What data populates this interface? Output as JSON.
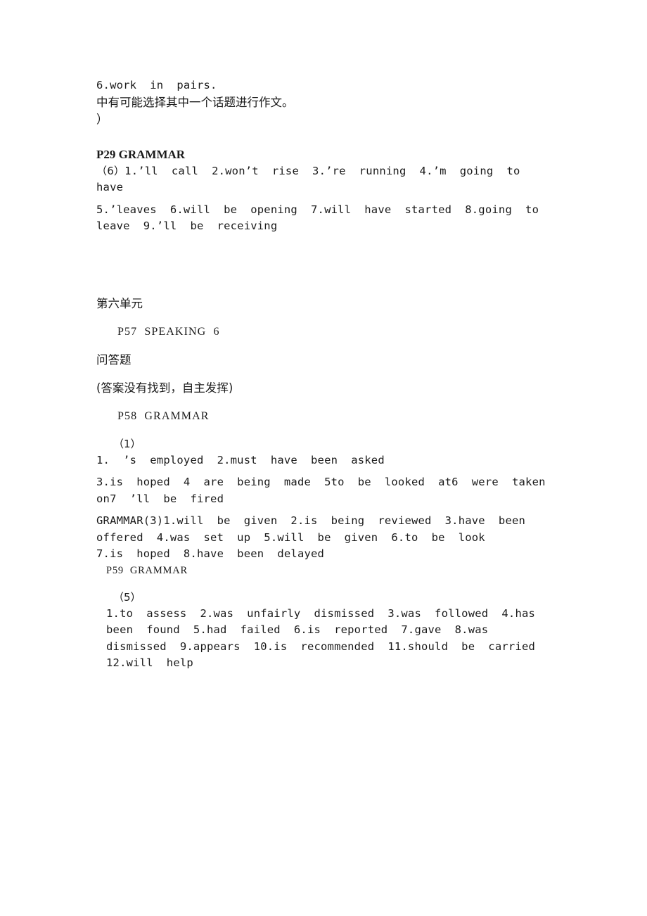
{
  "document": {
    "background_color": "#ffffff",
    "text_color": "#1a1a1a",
    "blocks": {
      "b1_line1": "6.work  in  pairs.",
      "b1_line2": "中有可能选择其中一个话题进行作文。",
      "b1_line3": "）",
      "p29_heading": "P29 GRAMMAR",
      "p29_marker": "（6）",
      "p29_answers_a": "1.’ll  call  2.won’t  rise  3.’re  running  4.’m  going  to  have",
      "p29_answers_b": "5.’leaves  6.will  be  opening  7.will  have  started  8.going  to  leave  9.’ll  be  receiving",
      "unit_title": "第六单元",
      "p57_heading": "P57  SPEAKING  6",
      "qa_label": "问答题",
      "qa_note": "(答案没有找到，自主发挥)",
      "p58_heading": "P58  GRAMMAR",
      "p58_marker": "（1）",
      "p58_answers_a": "1.  ’s  employed  2.must  have  been  asked",
      "p58_answers_b": "3.is  hoped  4  are  being  made  5to  be  looked  at6  were  taken  on7  ’ll  be  fired",
      "grammar3_answers": "GRAMMAR(3)1.will  be  given  2.is  being  reviewed  3.have  been  offered  4.was  set  up  5.will  be  given  6.to  be  look",
      "grammar3_tail": "7.is  hoped  8.have  been  delayed",
      "p59_heading": "P59  GRAMMAR",
      "p59_marker": "（5）",
      "p59_answers": "1.to  assess  2.was  unfairly  dismissed  3.was  followed  4.has  been  found  5.had  failed  6.is  reported  7.gave  8.was  dismissed  9.appears  10.is  recommended  11.should  be  carried  12.will  help"
    }
  }
}
